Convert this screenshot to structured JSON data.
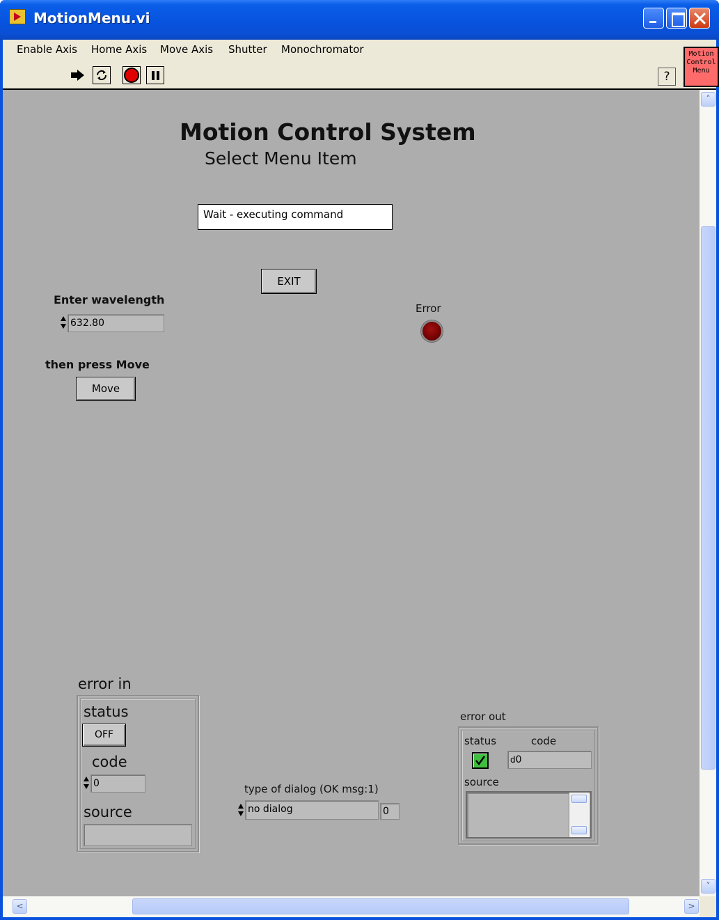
{
  "window": {
    "title": "MotionMenu.vi"
  },
  "menu": {
    "items": [
      "Enable Axis",
      "Home Axis",
      "Move Axis",
      "Shutter",
      "Monochromator"
    ]
  },
  "toolbar": {
    "help_label": "?",
    "vi_icon_line1": "Motion",
    "vi_icon_line2": "Control",
    "vi_icon_line3": "Menu"
  },
  "panel": {
    "title": "Motion Control System",
    "subtitle": "Select Menu Item",
    "status_text": "Wait - executing command",
    "exit_label": "EXIT",
    "wavelength_label": "Enter wavelength",
    "wavelength_value": "632.80",
    "then_label": "then press Move",
    "move_label": "Move",
    "error_led_label": "Error",
    "error_led_on": false
  },
  "error_in": {
    "label": "error in",
    "status_label": "status",
    "status_button": "OFF",
    "code_label": "code",
    "code_value": "0",
    "source_label": "source",
    "source_value": ""
  },
  "dialog_type": {
    "label": "type of dialog (OK msg:1)",
    "value": "no dialog",
    "numeric": "0"
  },
  "error_out": {
    "label": "error out",
    "status_label": "status",
    "code_label": "code",
    "code_value": "0",
    "code_prefix": "d",
    "source_label": "source",
    "source_value": "",
    "status_ok": true
  },
  "colors": {
    "panel_bg": "#adadad",
    "titlebar": "#0754e0",
    "led_off": "#6a0000",
    "checkbox_green": "#3fbf3f"
  }
}
